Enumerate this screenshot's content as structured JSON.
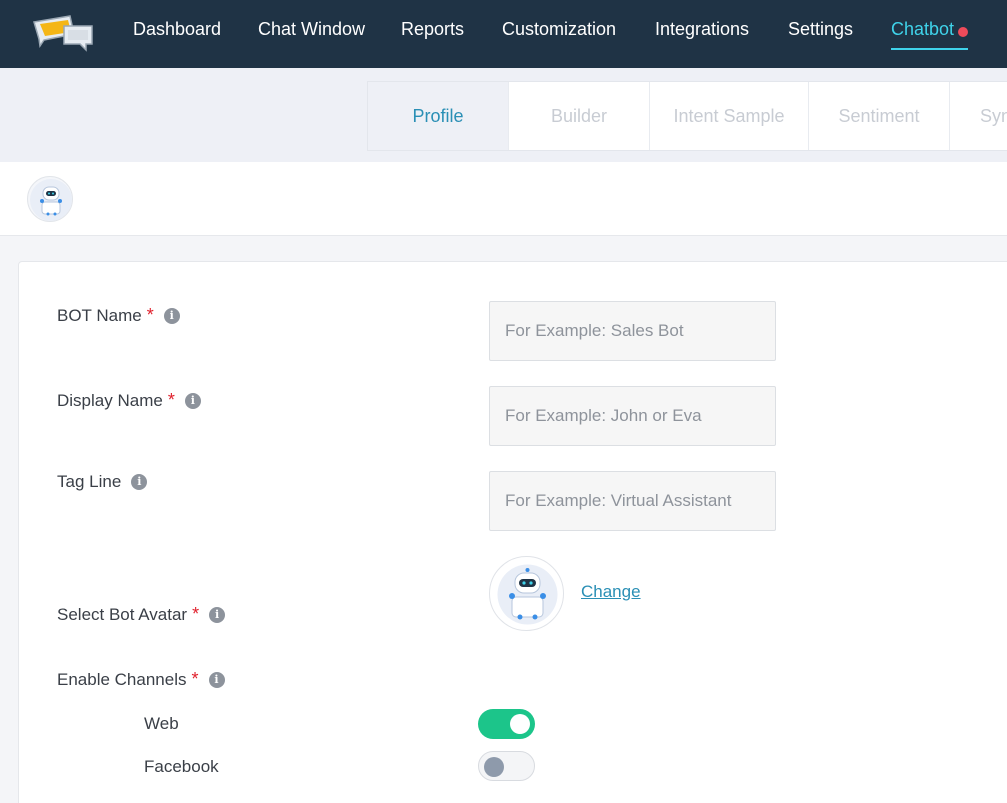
{
  "nav": {
    "items": [
      {
        "label": "Dashboard"
      },
      {
        "label": "Chat Window"
      },
      {
        "label": "Reports"
      },
      {
        "label": "Customization"
      },
      {
        "label": "Integrations"
      },
      {
        "label": "Settings"
      },
      {
        "label": "Chatbot"
      }
    ],
    "active_color": "#3fd3ea",
    "notification_color": "#ef4b5a"
  },
  "tabs": [
    {
      "label": "Profile"
    },
    {
      "label": "Builder"
    },
    {
      "label": "Intent Sample"
    },
    {
      "label": "Sentiment"
    },
    {
      "label": "Syn"
    }
  ],
  "form": {
    "bot_name": {
      "label": "BOT Name",
      "required": "*",
      "placeholder": "For Example: Sales Bot"
    },
    "display_name": {
      "label": "Display Name",
      "required": "*",
      "placeholder": "For Example: John or Eva"
    },
    "tag_line": {
      "label": "Tag Line",
      "placeholder": "For Example: Virtual Assistant"
    },
    "bot_avatar": {
      "label": "Select Bot Avatar",
      "required": "*",
      "change_label": "Change"
    },
    "channels": {
      "label": "Enable Channels",
      "required": "*",
      "items": [
        {
          "label": "Web",
          "enabled": true
        },
        {
          "label": "Facebook",
          "enabled": false
        }
      ]
    }
  },
  "colors": {
    "header_bg": "#1f3345",
    "link": "#2a8fb5",
    "toggle_on": "#1cc58a",
    "required": "#e0202c"
  }
}
